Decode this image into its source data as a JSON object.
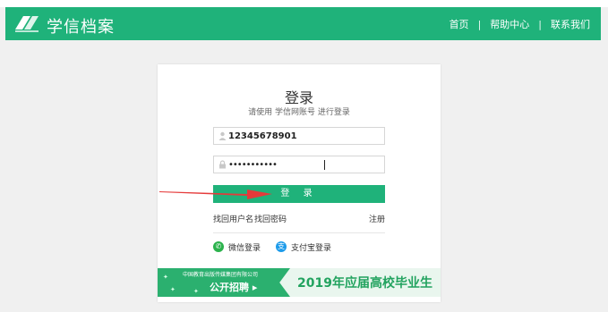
{
  "header": {
    "brand": "学信档案",
    "nav": [
      "首页",
      "帮助中心",
      "联系我们"
    ],
    "separator": "|"
  },
  "login": {
    "title": "登录",
    "subtitle": "请使用 学信网账号 进行登录",
    "username_value": "12345678901",
    "password_value": "•••••••••••",
    "button_label": "登 录",
    "links": [
      "找回用户名",
      "找回密码",
      "注册"
    ],
    "social": [
      {
        "label": "微信登录",
        "icon": "wechat-icon",
        "glyph": "✆"
      },
      {
        "label": "支付宝登录",
        "icon": "alipay-icon",
        "glyph": "支"
      }
    ]
  },
  "banner": {
    "small_text": "中国教育出版传媒集团有限公司",
    "big_text": "公开招聘 ▸",
    "right_text": "2019年应届高校毕业生"
  },
  "colors": {
    "brand_green": "#1fb27a",
    "arrow_red": "#e53a3a"
  }
}
